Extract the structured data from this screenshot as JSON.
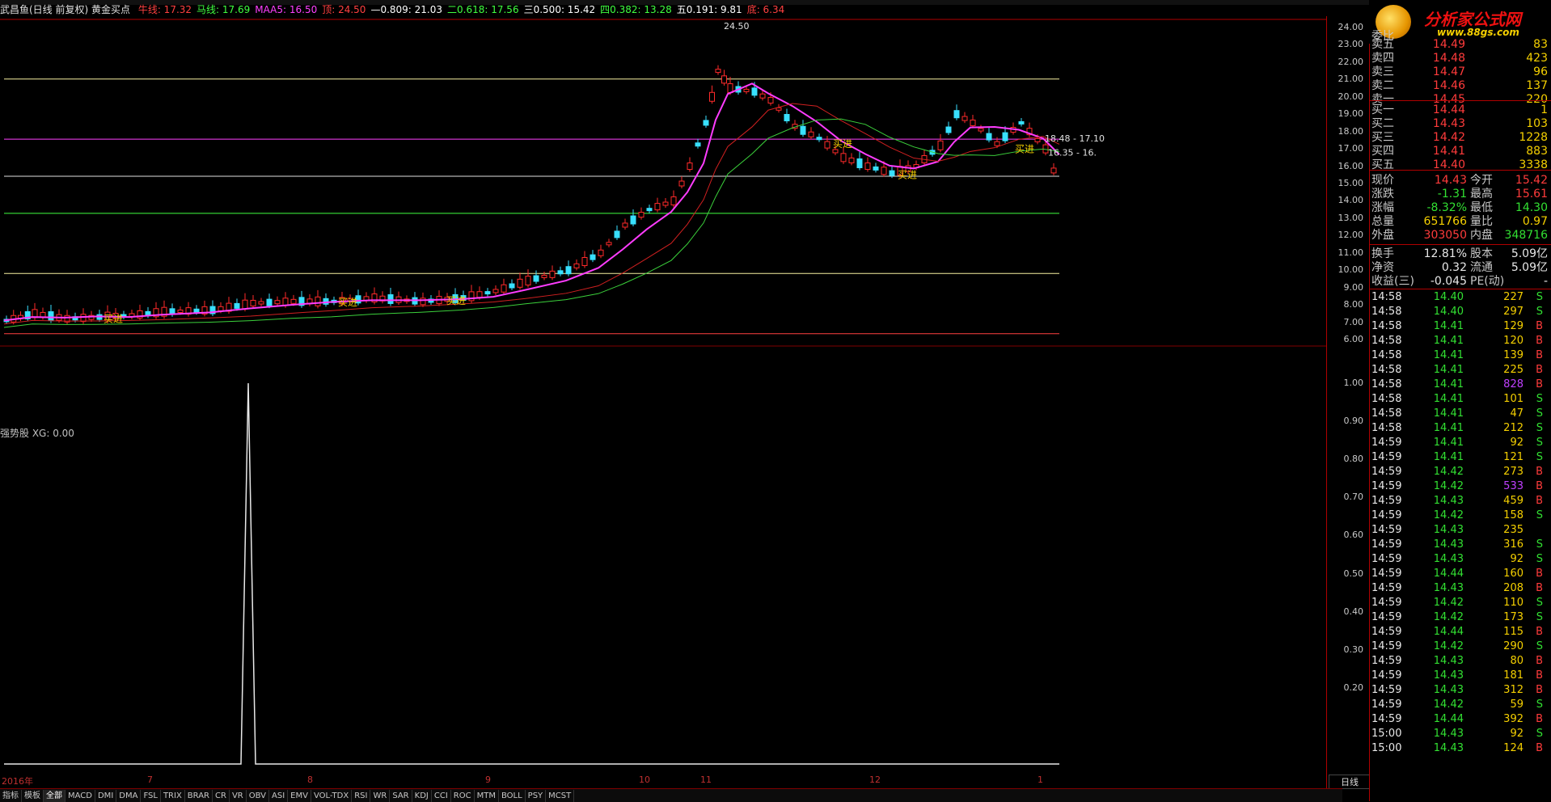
{
  "header": {
    "stock": "武昌鱼(日线 前复权) 黄金买点",
    "items": [
      {
        "label": "牛线: 17.32",
        "color": "#ff4040"
      },
      {
        "label": "马线: 17.69",
        "color": "#40ff40"
      },
      {
        "label": "MAA5: 16.50",
        "color": "#ff40ff"
      },
      {
        "label": "顶: 24.50",
        "color": "#ff4040"
      },
      {
        "label": "—0.809: 21.03",
        "color": "#ffffff"
      },
      {
        "label": "二0.618: 17.56",
        "color": "#40ff40"
      },
      {
        "label": "三0.500: 15.42",
        "color": "#ffffff"
      },
      {
        "label": "四0.382: 13.28",
        "color": "#40ff40"
      },
      {
        "label": "五0.191: 9.81",
        "color": "#ffffff"
      },
      {
        "label": "底: 6.34",
        "color": "#ff4040"
      }
    ]
  },
  "main_axis": [
    "24.00",
    "23.00",
    "22.00",
    "21.00",
    "20.00",
    "19.00",
    "18.00",
    "17.00",
    "16.00",
    "15.00",
    "14.00",
    "13.00",
    "12.00",
    "11.00",
    "10.00",
    "9.00",
    "8.00",
    "7.00",
    "6.00"
  ],
  "sub_axis": [
    "1.00",
    "0.90",
    "0.80",
    "0.70",
    "0.60",
    "0.50",
    "0.40",
    "0.30",
    "0.20"
  ],
  "sub_title": "强势股 XG: 0.00",
  "chart_labels": {
    "peak": "24.50",
    "buy": "买进",
    "range1": "18.48 - 17.10",
    "range2": "16.35 - 16."
  },
  "date_axis": [
    "2016年",
    "7",
    "8",
    "9",
    "10",
    "11",
    "12",
    "1"
  ],
  "period": "日线",
  "bottom_tabs": [
    "指标",
    "模板",
    "全部",
    "MACD",
    "DMI",
    "DMA",
    "FSL",
    "TRIX",
    "BRAR",
    "CR",
    "VR",
    "OBV",
    "ASI",
    "EMV",
    "VOL-TDX",
    "RSI",
    "WR",
    "SAR",
    "KDJ",
    "CCI",
    "ROC",
    "MTM",
    "BOLL",
    "PSY",
    "MCST"
  ],
  "bottom_tabs_active": 2,
  "logo": {
    "title": "分析家公式网",
    "url": "www.88gs.com"
  },
  "order_book": {
    "header": "委比",
    "asks": [
      {
        "label": "卖五",
        "price": "14.49",
        "vol": "83"
      },
      {
        "label": "卖四",
        "price": "14.48",
        "vol": "423"
      },
      {
        "label": "卖三",
        "price": "14.47",
        "vol": "96"
      },
      {
        "label": "卖二",
        "price": "14.46",
        "vol": "137"
      },
      {
        "label": "卖一",
        "price": "14.45",
        "vol": "220"
      }
    ],
    "bids": [
      {
        "label": "买一",
        "price": "14.44",
        "vol": "1"
      },
      {
        "label": "买二",
        "price": "14.43",
        "vol": "103"
      },
      {
        "label": "买三",
        "price": "14.42",
        "vol": "1228"
      },
      {
        "label": "买四",
        "price": "14.41",
        "vol": "883"
      },
      {
        "label": "买五",
        "price": "14.40",
        "vol": "3338"
      }
    ]
  },
  "quote": [
    {
      "l1": "现价",
      "v1": "14.43",
      "c1": "#ff3b3b",
      "l2": "今开",
      "v2": "15.42",
      "c2": "#ff3b3b"
    },
    {
      "l1": "涨跌",
      "v1": "-1.31",
      "c1": "#32e032",
      "l2": "最高",
      "v2": "15.61",
      "c2": "#ff3b3b"
    },
    {
      "l1": "涨幅",
      "v1": "-8.32%",
      "c1": "#32e032",
      "l2": "最低",
      "v2": "14.30",
      "c2": "#32e032"
    },
    {
      "l1": "总量",
      "v1": "651766",
      "c1": "#f5d000",
      "l2": "量比",
      "v2": "0.97",
      "c2": "#f5d000"
    },
    {
      "l1": "外盘",
      "v1": "303050",
      "c1": "#ff3b3b",
      "l2": "内盘",
      "v2": "348716",
      "c2": "#32e032"
    }
  ],
  "stats": [
    {
      "l1": "换手",
      "v1": "12.81%",
      "l2": "股本",
      "v2": "5.09亿"
    },
    {
      "l1": "净资",
      "v1": "0.32",
      "l2": "流通",
      "v2": "5.09亿"
    },
    {
      "l1": "收益(三)",
      "v1": "-0.045",
      "l2": "PE(动)",
      "v2": "-"
    }
  ],
  "ticks": [
    {
      "t": "14:58",
      "p": "14.40",
      "v": "227",
      "s": "S"
    },
    {
      "t": "14:58",
      "p": "14.40",
      "v": "297",
      "s": "S"
    },
    {
      "t": "14:58",
      "p": "14.41",
      "v": "129",
      "s": "B"
    },
    {
      "t": "14:58",
      "p": "14.41",
      "v": "120",
      "s": "B"
    },
    {
      "t": "14:58",
      "p": "14.41",
      "v": "139",
      "s": "B"
    },
    {
      "t": "14:58",
      "p": "14.41",
      "v": "225",
      "s": "B"
    },
    {
      "t": "14:58",
      "p": "14.41",
      "v": "828",
      "s": "B"
    },
    {
      "t": "14:58",
      "p": "14.41",
      "v": "101",
      "s": "S"
    },
    {
      "t": "14:58",
      "p": "14.41",
      "v": "47",
      "s": "S"
    },
    {
      "t": "14:58",
      "p": "14.41",
      "v": "212",
      "s": "S"
    },
    {
      "t": "14:59",
      "p": "14.41",
      "v": "92",
      "s": "S"
    },
    {
      "t": "14:59",
      "p": "14.41",
      "v": "121",
      "s": "S"
    },
    {
      "t": "14:59",
      "p": "14.42",
      "v": "273",
      "s": "B"
    },
    {
      "t": "14:59",
      "p": "14.42",
      "v": "533",
      "s": "B"
    },
    {
      "t": "14:59",
      "p": "14.43",
      "v": "459",
      "s": "B"
    },
    {
      "t": "14:59",
      "p": "14.42",
      "v": "158",
      "s": "S"
    },
    {
      "t": "14:59",
      "p": "14.43",
      "v": "235",
      "s": ""
    },
    {
      "t": "14:59",
      "p": "14.43",
      "v": "316",
      "s": "S"
    },
    {
      "t": "14:59",
      "p": "14.43",
      "v": "92",
      "s": "S"
    },
    {
      "t": "14:59",
      "p": "14.44",
      "v": "160",
      "s": "B"
    },
    {
      "t": "14:59",
      "p": "14.43",
      "v": "208",
      "s": "B"
    },
    {
      "t": "14:59",
      "p": "14.42",
      "v": "110",
      "s": "S"
    },
    {
      "t": "14:59",
      "p": "14.42",
      "v": "173",
      "s": "S"
    },
    {
      "t": "14:59",
      "p": "14.44",
      "v": "115",
      "s": "B"
    },
    {
      "t": "14:59",
      "p": "14.42",
      "v": "290",
      "s": "S"
    },
    {
      "t": "14:59",
      "p": "14.43",
      "v": "80",
      "s": "B"
    },
    {
      "t": "14:59",
      "p": "14.43",
      "v": "181",
      "s": "B"
    },
    {
      "t": "14:59",
      "p": "14.43",
      "v": "312",
      "s": "B"
    },
    {
      "t": "14:59",
      "p": "14.42",
      "v": "59",
      "s": "S"
    },
    {
      "t": "14:59",
      "p": "14.44",
      "v": "392",
      "s": "B"
    },
    {
      "t": "15:00",
      "p": "14.43",
      "v": "92",
      "s": "S"
    },
    {
      "t": "15:00",
      "p": "14.43",
      "v": "124",
      "s": "B"
    }
  ],
  "colors": {
    "up": "#ff2a2a",
    "down": "#38e0ff",
    "ma_pink": "#ff3cff",
    "ma_green": "#3bd03b",
    "ma_red": "#d02020",
    "buy_label": "#f5d000"
  }
}
